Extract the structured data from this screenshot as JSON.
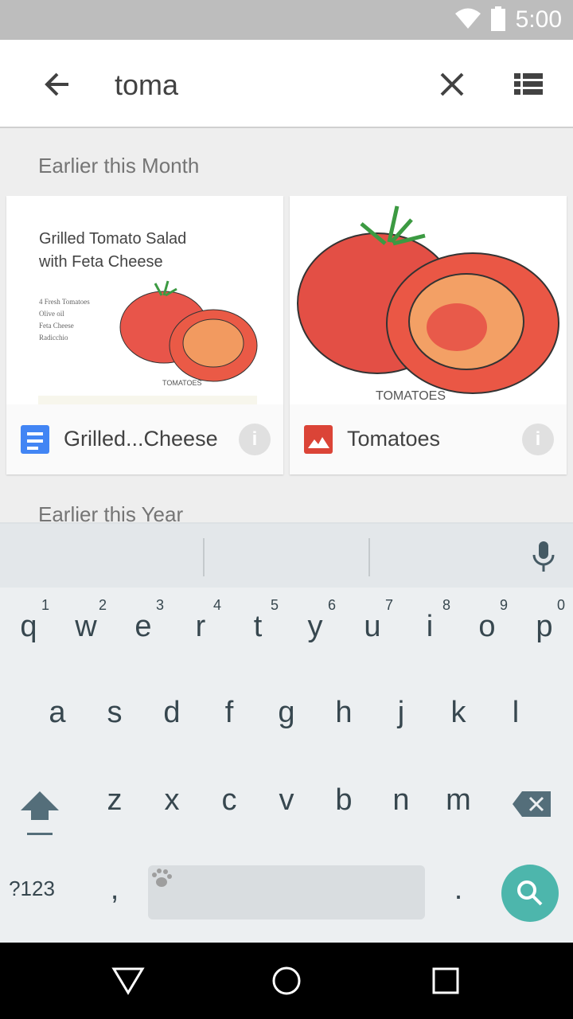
{
  "status_bar": {
    "time": "5:00",
    "icons": [
      "wifi-icon",
      "battery-icon"
    ]
  },
  "toolbar": {
    "query": "toma",
    "icons": [
      "back-arrow-icon",
      "clear-icon",
      "list-view-icon"
    ]
  },
  "sections": [
    {
      "label": "Earlier this Month"
    },
    {
      "label": "Earlier this Year"
    }
  ],
  "cards": [
    {
      "title": "Grilled...Cheese",
      "type_icon": "docs-icon",
      "accent": "#4285f4",
      "thumb": {
        "heading_line1": "Grilled Tomato Salad",
        "heading_line2": "with Feta Cheese",
        "ingredients": [
          "4 Fresh Tomatoes",
          "Olive oil",
          "Feta Cheese",
          "Radicchio"
        ],
        "caption": "TOMATOES"
      }
    },
    {
      "title": "Tomatoes",
      "type_icon": "image-icon",
      "accent": "#db4437",
      "thumb": {
        "caption": "TOMATOES"
      }
    }
  ],
  "keyboard": {
    "row1": [
      "q",
      "w",
      "e",
      "r",
      "t",
      "y",
      "u",
      "i",
      "o",
      "p"
    ],
    "row1_hints": [
      "1",
      "2",
      "3",
      "4",
      "5",
      "6",
      "7",
      "8",
      "9",
      "0"
    ],
    "row2": [
      "a",
      "s",
      "d",
      "f",
      "g",
      "h",
      "j",
      "k",
      "l"
    ],
    "row3": [
      "z",
      "x",
      "c",
      "v",
      "b",
      "n",
      "m"
    ],
    "symbols_label": "?123",
    "comma": ",",
    "period": ".",
    "action_color": "#4db6ac"
  },
  "nav_bar": {
    "icons": [
      "back-triangle-icon",
      "home-circle-icon",
      "recents-square-icon"
    ]
  }
}
